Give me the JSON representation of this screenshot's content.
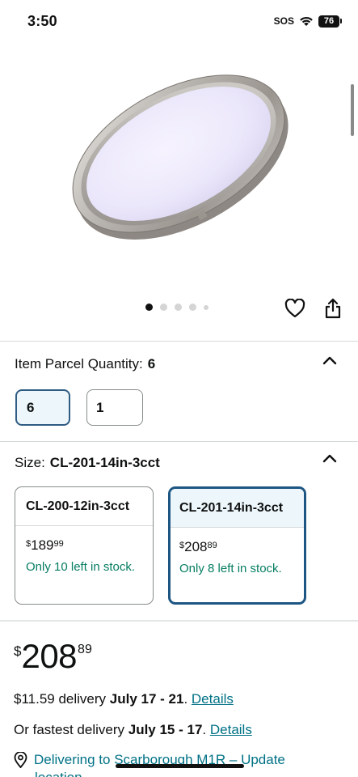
{
  "status_bar": {
    "time": "3:50",
    "sos": "SOS",
    "battery": "76"
  },
  "product": {
    "image_alt": "Round brushed nickel LED ceiling flush mount light",
    "carousel_total": 5,
    "carousel_active": 1
  },
  "parcel": {
    "label": "Item Parcel Quantity:",
    "selected": "6",
    "options": [
      "6",
      "1"
    ]
  },
  "size": {
    "label": "Size:",
    "selected": "CL-201-14in-3cct",
    "options": [
      {
        "name": "CL-200-12in-3cct",
        "currency": "$",
        "whole": "189",
        "fraction": "99",
        "stock": "Only 10 left in stock."
      },
      {
        "name": "CL-201-14in-3cct",
        "currency": "$",
        "whole": "208",
        "fraction": "89",
        "stock": "Only 8 left in stock."
      }
    ]
  },
  "price": {
    "currency": "$",
    "whole": "208",
    "fraction": "89"
  },
  "delivery": {
    "line1_prefix": "$11.59 delivery",
    "line1_dates": "July 17 - 21",
    "line1_sep": ". ",
    "details_label": "Details",
    "line2_prefix": "Or fastest delivery",
    "line2_dates": "July 15 - 17",
    "line2_sep": ". ",
    "location_text": "Delivering to Scarborough M1R – Update",
    "location_cont": "location"
  },
  "colors": {
    "link": "#007185",
    "stock": "#067d62",
    "selected_border": "#1d5683"
  }
}
